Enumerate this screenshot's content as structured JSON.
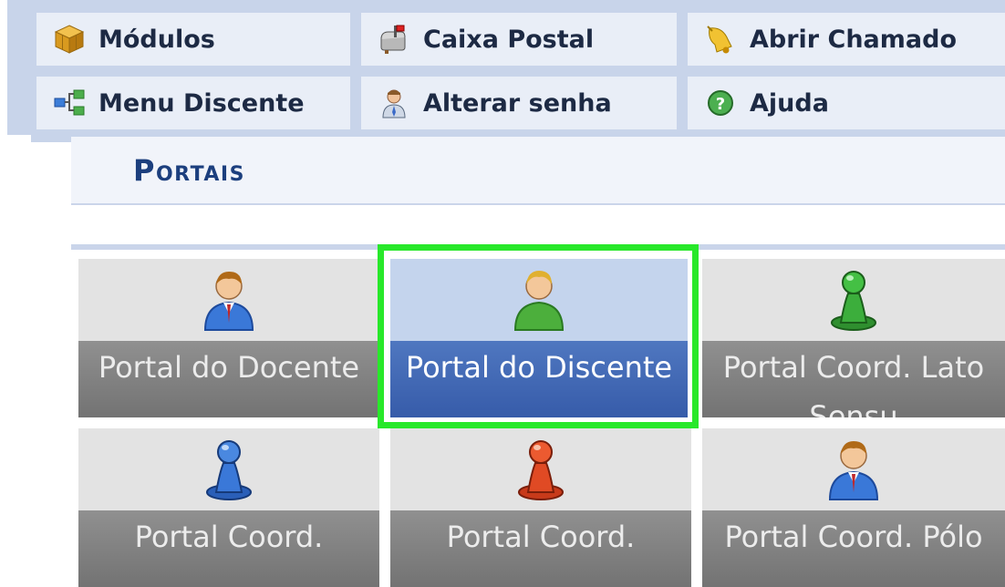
{
  "menu": {
    "modulos": "Módulos",
    "caixa_postal": "Caixa Postal",
    "abrir_chamado": "Abrir Chamado",
    "menu_discente": "Menu Discente",
    "alterar_senha": "Alterar senha",
    "ajuda": "Ajuda"
  },
  "section_title": "Portais",
  "portals": [
    {
      "label": "Portal do Docente",
      "icon": "user-suit-icon",
      "active": false
    },
    {
      "label": "Portal do Discente",
      "icon": "user-green-icon",
      "active": true
    },
    {
      "label": "Portal Coord. Lato Sensu",
      "icon": "pawn-green-icon",
      "active": false
    },
    {
      "label": "Portal Coord.",
      "icon": "pawn-blue-icon",
      "active": false
    },
    {
      "label": "Portal Coord.",
      "icon": "pawn-red-icon",
      "active": false
    },
    {
      "label": "Portal Coord. Pólo",
      "icon": "user-suit-icon",
      "active": false
    }
  ],
  "colors": {
    "highlight": "#28e82a",
    "active_tile": "#3c63b0",
    "title": "#1c3f7e"
  }
}
